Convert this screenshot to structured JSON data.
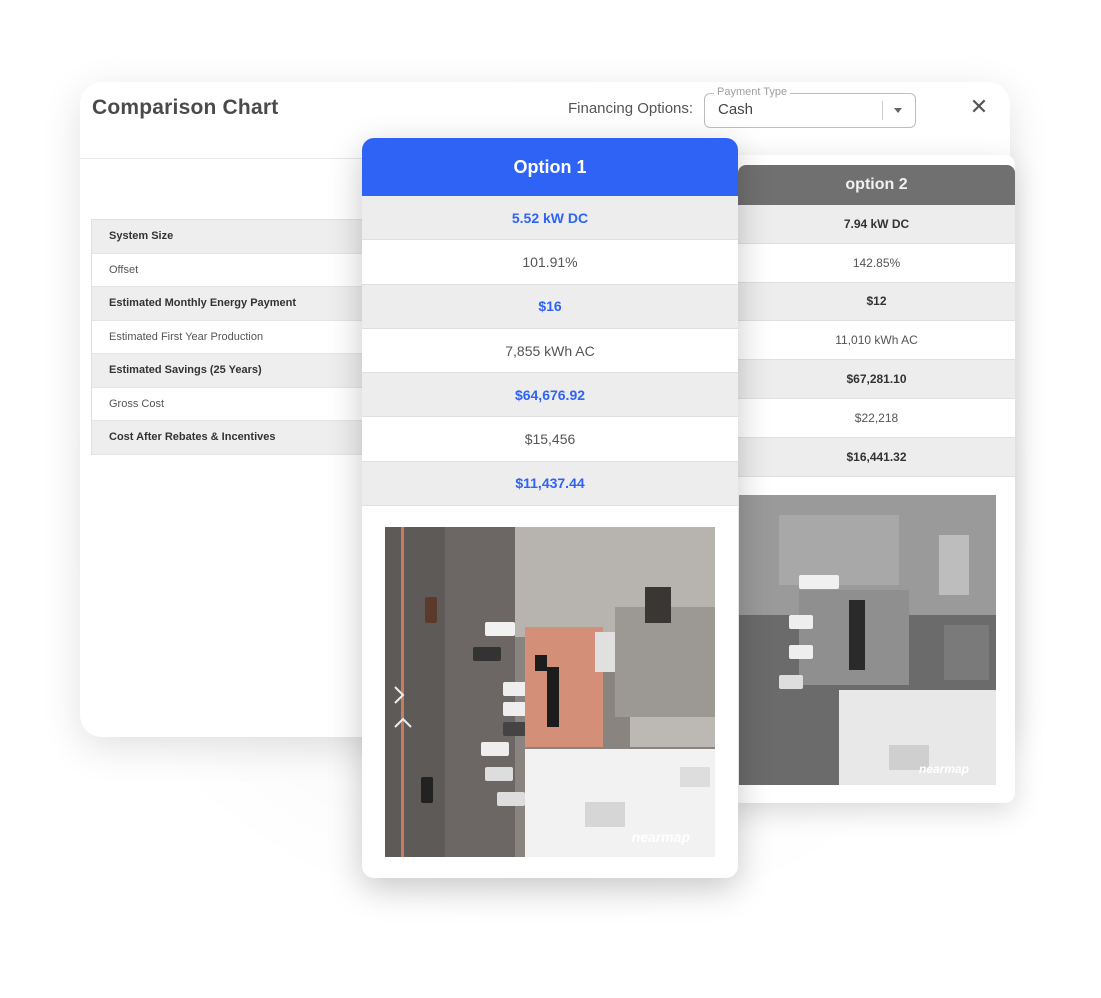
{
  "header": {
    "title": "Comparison Chart",
    "financing_label": "Financing Options:",
    "payment_type_label": "Payment Type",
    "payment_type_value": "Cash",
    "close_glyph": "✕"
  },
  "labels": [
    "System Size",
    "Offset",
    "Estimated Monthly Energy Payment",
    "Estimated First Year Production",
    "Estimated Savings (25 Years)",
    "Gross Cost",
    "Cost After Rebates & Incentives"
  ],
  "option1": {
    "title": "Option 1",
    "values": [
      "5.52 kW DC",
      "101.91%",
      "$16",
      "7,855 kWh AC",
      "$64,676.92",
      "$15,456",
      "$11,437.44"
    ],
    "watermark": "nearmap"
  },
  "option2": {
    "title": "option 2",
    "values": [
      "7.94 kW DC",
      "142.85%",
      "$12",
      "11,010 kWh AC",
      "$67,281.10",
      "$22,218",
      "$16,441.32"
    ],
    "watermark": "nearmap"
  },
  "colors": {
    "accent_blue": "#2e63f6",
    "option2_header": "#707070",
    "roof_highlight": "#d48f78"
  },
  "icons": {
    "close": "close-icon",
    "dropdown": "chevron-down-icon"
  }
}
